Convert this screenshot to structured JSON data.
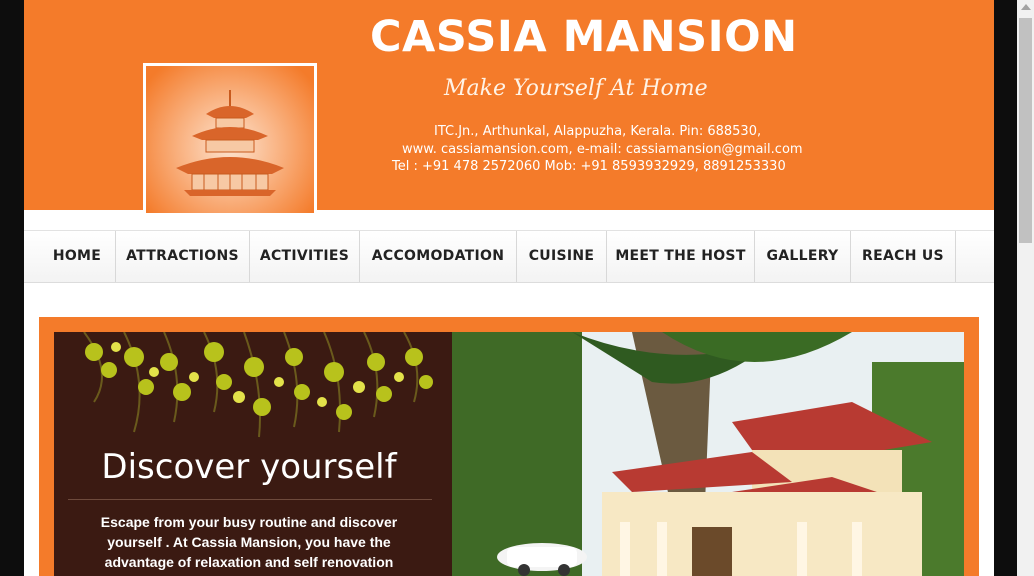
{
  "header": {
    "title": "CASSIA MANSION",
    "tagline": "Make Yourself At Home",
    "address": "ITC.Jn., Arthunkal, Alappuzha, Kerala. Pin: 688530,",
    "web_email": "www. cassiamansion.com, e-mail: cassiamansion@gmail.com",
    "phones": "Tel :    +91 478 2572060 Mob: +91 8593932929, 8891253330",
    "logo_icon": "pagoda-icon",
    "colors": {
      "brand": "#f47b2a",
      "slide_panel": "#3b1a12"
    }
  },
  "nav": {
    "items": [
      {
        "label": "HOME"
      },
      {
        "label": "ATTRACTIONS"
      },
      {
        "label": "ACTIVITIES"
      },
      {
        "label": "ACCOMODATION"
      },
      {
        "label": "CUISINE"
      },
      {
        "label": "MEET THE HOST"
      },
      {
        "label": "GALLERY"
      },
      {
        "label": "REACH US"
      }
    ]
  },
  "slider": {
    "heading": "Discover yourself",
    "text": "Escape from your busy routine and discover yourself . At Cassia Mansion, you have the advantage of relaxation and self renovation"
  }
}
